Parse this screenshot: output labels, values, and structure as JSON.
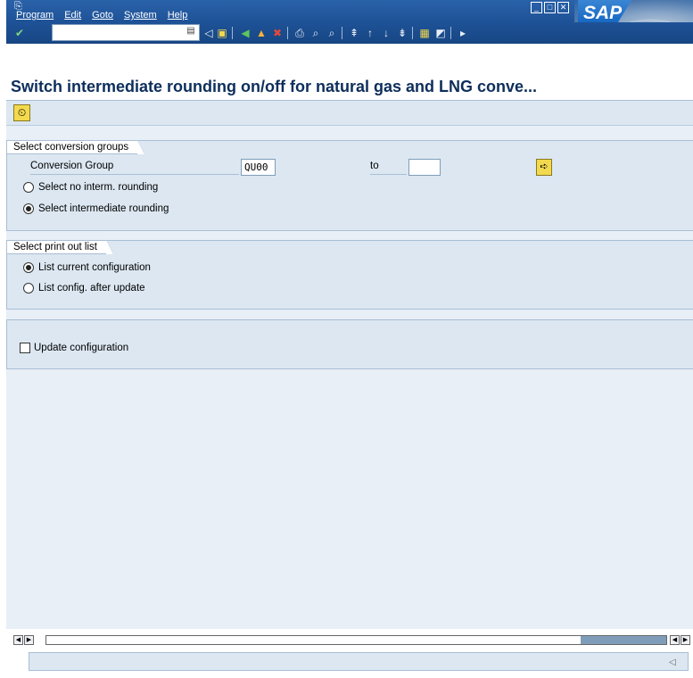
{
  "menubar": {
    "items": [
      "Program",
      "Edit",
      "Goto",
      "System",
      "Help"
    ]
  },
  "logo": {
    "text": "SAP"
  },
  "page": {
    "title": "Switch intermediate rounding on/off for natural gas and LNG conve..."
  },
  "conversion_groups": {
    "title": "Select conversion groups",
    "field_label": "Conversion Group",
    "from_value": "QU00",
    "to_label": "to",
    "to_value": "",
    "radio_no_rounding": "Select no interm. rounding",
    "radio_intermediate": "Select intermediate rounding",
    "selected": "intermediate"
  },
  "print_list": {
    "title": "Select print out list",
    "radio_current": "List current configuration",
    "radio_after_update": "List config. after update",
    "selected": "current"
  },
  "update": {
    "checkbox_label": "Update configuration",
    "checked": false
  },
  "colors": {
    "title_bar": "#2a62a9",
    "page_title": "#0d2e5c",
    "group_bg": "#dce7f1",
    "exec_button": "#f3d94e"
  }
}
